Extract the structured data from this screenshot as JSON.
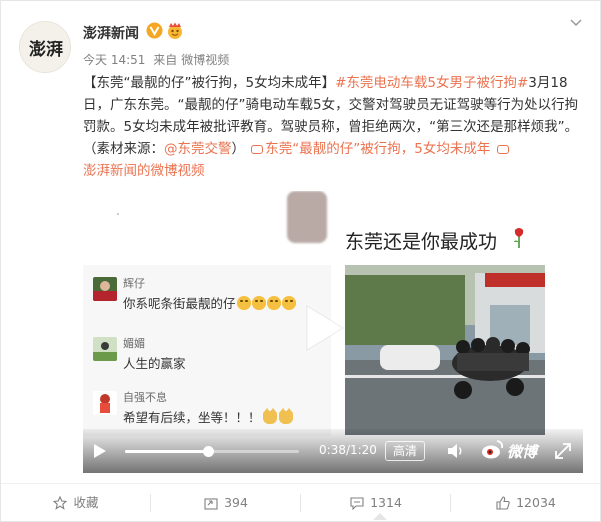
{
  "post": {
    "author": "澎湃新闻",
    "avatar_text": "澎湃",
    "time": "今天 14:51",
    "source_prefix": "来自",
    "source": "微博视频",
    "text_parts": {
      "title": "【东莞“最靓的仔”被行拘，5女均未成年】",
      "hashtag": "#东莞电动车载5女男子被行拘#",
      "body": "3月18日，广东东莞。“最靓的仔”骑电动车载5女，交警对驾驶员无证驾驶等行为处以行拘罚款。5女均未成年被批评教育。驾驶员称，曾拒绝两次，“第三次还是那样烦我”。（素材来源：",
      "mention": "@东莞交警",
      "close": "）",
      "video_link": "东莞“最靓的仔”被行拘，5女均未成年",
      "channel": "澎湃新闻的微博视频"
    }
  },
  "video": {
    "headline": "东莞还是你最成功",
    "comments": [
      {
        "name": "辉仔",
        "text": "你系呢条街最靓的仔"
      },
      {
        "name": "媚媚",
        "text": "人生的赢家"
      },
      {
        "name": "自强不息",
        "text": "希望有后续，坐等！！！"
      }
    ],
    "current_time": "0:38",
    "duration": "1:20",
    "time_display": "0:38/1:20",
    "progress": 0.475,
    "quality_label": "高清",
    "logo_text": "微博"
  },
  "actions": {
    "favorite": "收藏",
    "repost": "394",
    "comment": "1314",
    "like": "12034"
  },
  "colors": {
    "link": "#eb7350",
    "meta": "#808080",
    "verified": "#f5a623"
  },
  "icons": [
    "chevron-down-icon",
    "verified-icon",
    "vip-icon",
    "play-icon",
    "volume-icon",
    "fullscreen-icon",
    "star-icon",
    "repost-icon",
    "comment-icon",
    "like-icon"
  ]
}
